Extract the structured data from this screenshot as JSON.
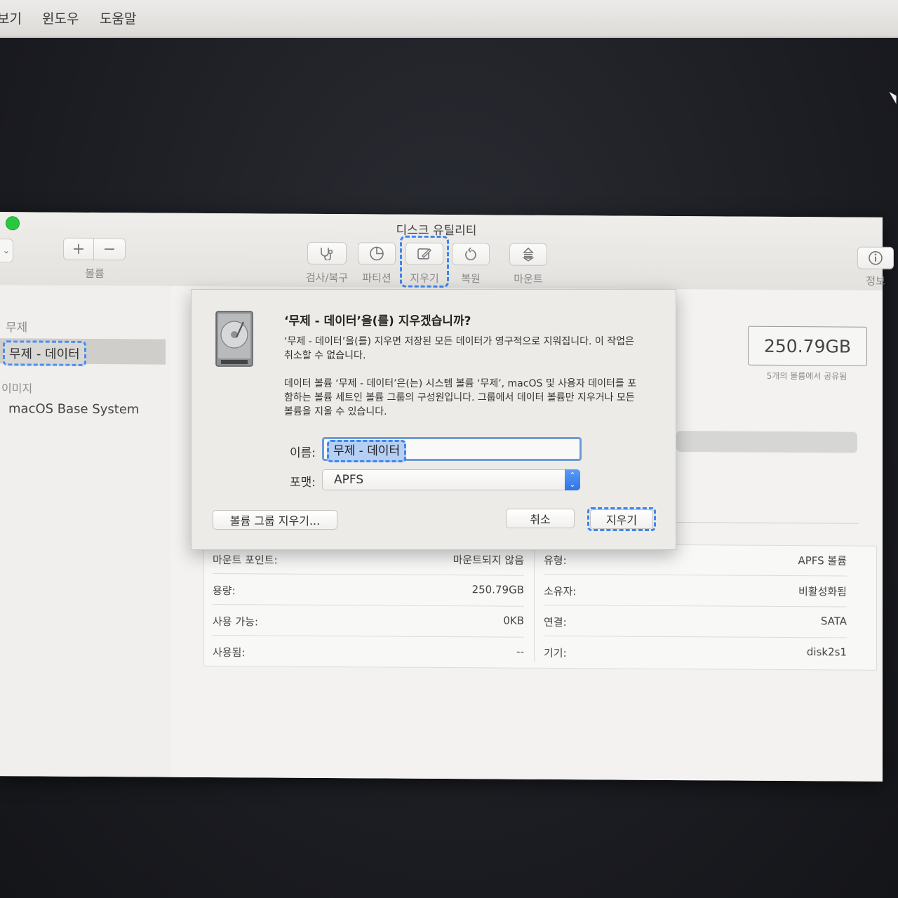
{
  "menubar": {
    "items": [
      "보기",
      "윈도우",
      "도움말"
    ]
  },
  "window": {
    "title": "디스크 유틸리티"
  },
  "toolbar": {
    "volume_label": "볼륨",
    "add_symbol": "+",
    "remove_symbol": "−",
    "first_aid": "검사/복구",
    "partition": "파티션",
    "erase": "지우기",
    "restore": "복원",
    "mount": "마운트",
    "info": "정보"
  },
  "sidebar": {
    "group1": "무제",
    "selected": "무제 - 데이터",
    "group2": "이미지",
    "item_image": "macOS Base System"
  },
  "content": {
    "capacity": "250.79GB",
    "capacity_note": "5개의 볼륨에서 공유됨",
    "info_left": [
      {
        "k": "마운트 포인트:",
        "v": "마운트되지 않음"
      },
      {
        "k": "용량:",
        "v": "250.79GB"
      },
      {
        "k": "사용 가능:",
        "v": "0KB"
      },
      {
        "k": "사용됨:",
        "v": "--"
      }
    ],
    "info_right": [
      {
        "k": "유형:",
        "v": "APFS 볼륨"
      },
      {
        "k": "소유자:",
        "v": "비활성화됨"
      },
      {
        "k": "연결:",
        "v": "SATA"
      },
      {
        "k": "기기:",
        "v": "disk2s1"
      }
    ]
  },
  "dialog": {
    "title": "‘무제 - 데이터’을(를) 지우겠습니까?",
    "para1_line1": "‘무제 - 데이터’을(를) 지우면 저장된 모든 데이터가 영구적으로 지워집니다. 이 작업은",
    "para1_line2": "취소할 수 없습니다.",
    "para2_line1": "데이터 볼륨 ‘무제 - 데이터’은(는) 시스템 볼륨 ‘무제’, macOS 및 사용자 데이터를 포",
    "para2_line2": "함하는 볼륨 세트인 볼륨 그룹의 구성원입니다. 그룹에서 데이터 볼륨만 지우거나 모든",
    "para2_line3": "볼륨을 지울 수 있습니다.",
    "name_label": "이름:",
    "name_value": "무제 - 데이터",
    "format_label": "포맷:",
    "format_value": "APFS",
    "erase_group_button": "볼륨 그룹 지우기...",
    "cancel_button": "취소",
    "erase_button": "지우기"
  }
}
